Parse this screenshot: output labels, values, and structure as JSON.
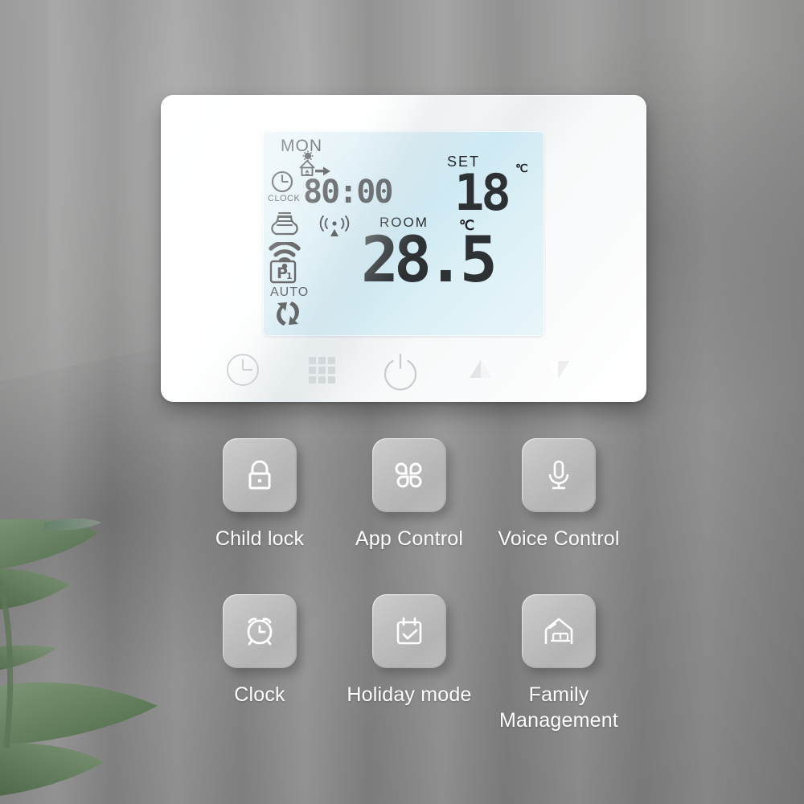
{
  "scene": {
    "background_color": "#8e8e8e",
    "accent_color": "#cfe9f3",
    "plant_color": "#5e7a57"
  },
  "device": {
    "name": "smart-wifi-thermostat",
    "body_color": "#ffffff",
    "lcd": {
      "background_color": "#d7edf5",
      "digit_color": "#2d3133",
      "day": "MON",
      "clock_label": "CLOCK",
      "clock_value": "80:00",
      "set_label": "SET",
      "set_value": "18",
      "set_unit": "℃",
      "room_label": "ROOM",
      "room_value": "28.5",
      "room_unit": "℃",
      "program_label": "P₁",
      "auto_label": "AUTO",
      "icons": [
        "holiday-away-icon",
        "clock-icon",
        "heating-radiator-icon",
        "wifi-icon",
        "signal-antenna-icon",
        "program-p1-icon",
        "auto-cycle-icon"
      ]
    },
    "buttons": [
      {
        "name": "clock-button",
        "icon": "clock-icon",
        "label": "Clock / timer"
      },
      {
        "name": "menu-button",
        "icon": "grid-menu-icon",
        "label": "Menu"
      },
      {
        "name": "power-button",
        "icon": "power-icon",
        "label": "Power"
      },
      {
        "name": "temperature-up-button",
        "icon": "triangle-up-icon",
        "label": "Up"
      },
      {
        "name": "temperature-down-button",
        "icon": "triangle-down-icon",
        "label": "Down"
      }
    ]
  },
  "features": {
    "tile_color": "#bdbdbd",
    "label_color": "#ffffff",
    "rows": [
      [
        {
          "name": "feature-child-lock",
          "icon": "lock-icon",
          "label": "Child lock"
        },
        {
          "name": "feature-app-control",
          "icon": "clover-apps-icon",
          "label": "App Control"
        },
        {
          "name": "feature-voice-control",
          "icon": "microphone-icon",
          "label": "Voice Control"
        }
      ],
      [
        {
          "name": "feature-clock",
          "icon": "alarm-clock-icon",
          "label": "Clock"
        },
        {
          "name": "feature-holiday-mode",
          "icon": "calendar-check-icon",
          "label": "Holiday mode"
        },
        {
          "name": "feature-family-management",
          "icon": "house-sofa-icon",
          "label": "Family\nManagement"
        }
      ]
    ]
  }
}
